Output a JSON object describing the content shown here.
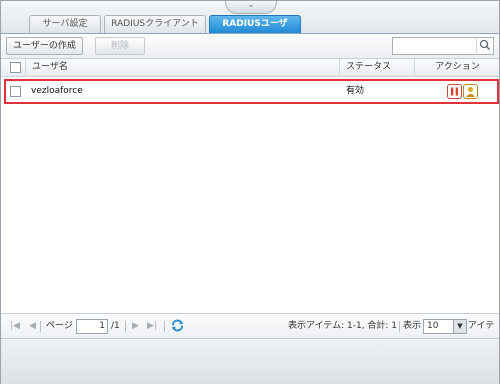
{
  "tabs": [
    {
      "label": "サーバ設定",
      "active": false
    },
    {
      "label": "RADIUSクライアント",
      "active": false
    },
    {
      "label": "RADIUSユーザ",
      "active": true
    }
  ],
  "toolbar": {
    "create_label": "ユーザーの作成",
    "delete_label": "削除",
    "search_value": ""
  },
  "grid": {
    "headers": {
      "username": "ユーザ名",
      "status": "ステータス",
      "action": "アクション"
    },
    "rows": [
      {
        "username": "vezloaforce",
        "status": "有効"
      }
    ]
  },
  "pager": {
    "page_label": "ページ",
    "page_value": "1",
    "total_pages": "/1",
    "items_info": "表示アイテム: 1-1, 合計: 1",
    "show_label": "表示",
    "page_size": "10",
    "items_label": "アイテム"
  },
  "colors": {
    "accent": "#1f8ad6",
    "highlight_border": "#e0323a",
    "action_pause": "#d9422f",
    "action_edit": "#e0a81f"
  }
}
